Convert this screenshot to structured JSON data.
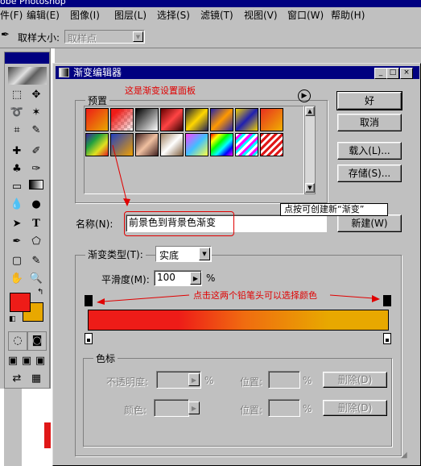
{
  "app_title": "obe Photoshop",
  "menu": [
    "件(F)",
    "编辑(E)",
    "图像(I)",
    "图层(L)",
    "选择(S)",
    "滤镜(T)",
    "视图(V)",
    "窗口(W)",
    "帮助(H)"
  ],
  "options_bar": {
    "sample_size_label": "取样大小:",
    "sample_size_value": "取样点"
  },
  "dialog": {
    "title": "渐变编辑器",
    "presets_label": "预置",
    "buttons": {
      "ok": "好",
      "cancel": "取消",
      "load": "载入(L)...",
      "save": "存储(S)...",
      "new": "新建(W)"
    },
    "name_label": "名称(N):",
    "name_value": "前景色到背景色渐变",
    "gradient_type_label": "渐变类型(T):",
    "gradient_type_value": "实底",
    "smoothness_label": "平滑度(M):",
    "smoothness_value": "100",
    "smoothness_unit": "%",
    "color_stops": {
      "label": "色标",
      "opacity_label": "不透明度:",
      "color_label": "颜色:",
      "location_label": "位置:",
      "percent": "%",
      "delete_label": "删除(D)"
    }
  },
  "annotations": {
    "panel": "这是渐变设置面板",
    "new_tip": "点按可创建新“渐变”",
    "pencil_tip": "点击这两个铅笔头可以选择颜色"
  },
  "colors": {
    "foreground": "#ee1c18",
    "background": "#e8a800",
    "title_bar": "#000080",
    "annotation": "#e00000"
  }
}
